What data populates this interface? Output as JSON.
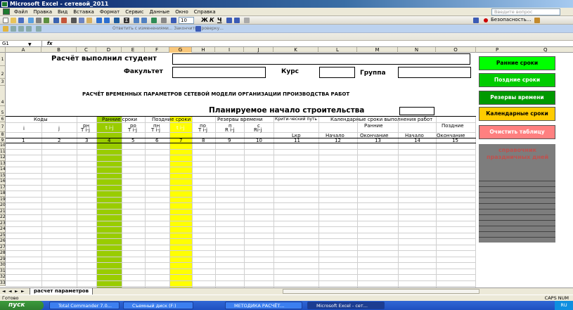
{
  "title": "Microsoft Excel - сетевой_2011",
  "menu": [
    "Файл",
    "Правка",
    "Вид",
    "Вставка",
    "Формат",
    "Сервис",
    "Данные",
    "Окно",
    "Справка"
  ],
  "help_placeholder": "Введите вопрос",
  "toolbar": {
    "font_size": "10",
    "security_label": "Безопасность...",
    "review_text": "Ответить с изменениями...  Закончить проверку..."
  },
  "name_box": "G1",
  "fx": "fx",
  "columns": [
    "A",
    "B",
    "C",
    "D",
    "E",
    "F",
    "G",
    "H",
    "I",
    "J",
    "K",
    "L",
    "M",
    "N",
    "O"
  ],
  "right_columns": [
    "P",
    "Q"
  ],
  "row_numbers": [
    "1",
    "2",
    "3",
    "4",
    "5",
    "6",
    "7",
    "8",
    "9",
    "10",
    "11",
    "12",
    "13",
    "14",
    "15",
    "16",
    "17",
    "18",
    "19",
    "20",
    "21",
    "22",
    "23",
    "24",
    "25",
    "26",
    "27",
    "28",
    "29",
    "30",
    "31",
    "32",
    "33"
  ],
  "sheet": {
    "student_label": "Расчёт выполнил студент",
    "faculty_label": "Факультет",
    "course_label": "Курс",
    "group_label": "Группа",
    "main_title": "РАСЧЁТ ВРЕМЕННЫХ ПАРАМЕТРОВ СЕТЕВОЙ МОДЕЛИ ОРГАНИЗАЦИИ ПРОИЗВОДСТВА РАБОТ",
    "start_label": "Планируемое начало строительства",
    "h6": {
      "codes": "Коды",
      "early": "Ранние сроки",
      "late": "Поздние сроки",
      "reserves": "Резервы времени",
      "critical": "Крити-ческий путь",
      "calendar": "Календарные сроки выполнения работ"
    },
    "h7": {
      "i": "i",
      "j": "j",
      "rn1": "рн",
      "rn2": "T i-j",
      "tij": "t i-j",
      "ro1": "ро",
      "ro2": "T i-j",
      "pn1": "пн",
      "pn2": "T i-j",
      "tij2": "t i-j",
      "po1": "по",
      "po2": "T i-j",
      "n1": "п",
      "n2": "R i-j",
      "c1": "с",
      "c2": "Ri-j",
      "early": "Ранние",
      "late": "Поздние"
    },
    "h8": {
      "lkr": "Lкр",
      "s1": "Начало",
      "e1": "Окончание",
      "s2": "Начало",
      "e2": "Окончание"
    },
    "nums": [
      "1",
      "2",
      "3",
      "4",
      "5",
      "6",
      "7",
      "8",
      "9",
      "10",
      "11",
      "12",
      "13",
      "14",
      "15"
    ]
  },
  "buttons": {
    "early": "Ранние сроки",
    "late": "Поздние сроки",
    "reserves": "Резервы времени",
    "calendar": "Календарные сроки",
    "clear": "Очистить таблицу"
  },
  "holiday_title": "справочник праздничных дней",
  "sheet_tab": "расчет параметров",
  "status": {
    "ready": "Готово",
    "caps": "CAPS NUM"
  },
  "taskbar": {
    "start": "пуск",
    "items": [
      "Total Commander 7.0...",
      "Съемный диск (F:)",
      "МЕТОДИКА РАСЧЁТ...",
      "Microsoft Excel - сет..."
    ],
    "lang": "RU"
  },
  "colors": {
    "green_col": "#99cc00",
    "yellow_col": "#ffff00",
    "btn_early": "#00ff00",
    "btn_late": "#00cc00",
    "btn_reserves": "#009900",
    "btn_calendar": "#ffcc00",
    "btn_clear": "#ff8080",
    "holiday_text": "#c0504d"
  }
}
